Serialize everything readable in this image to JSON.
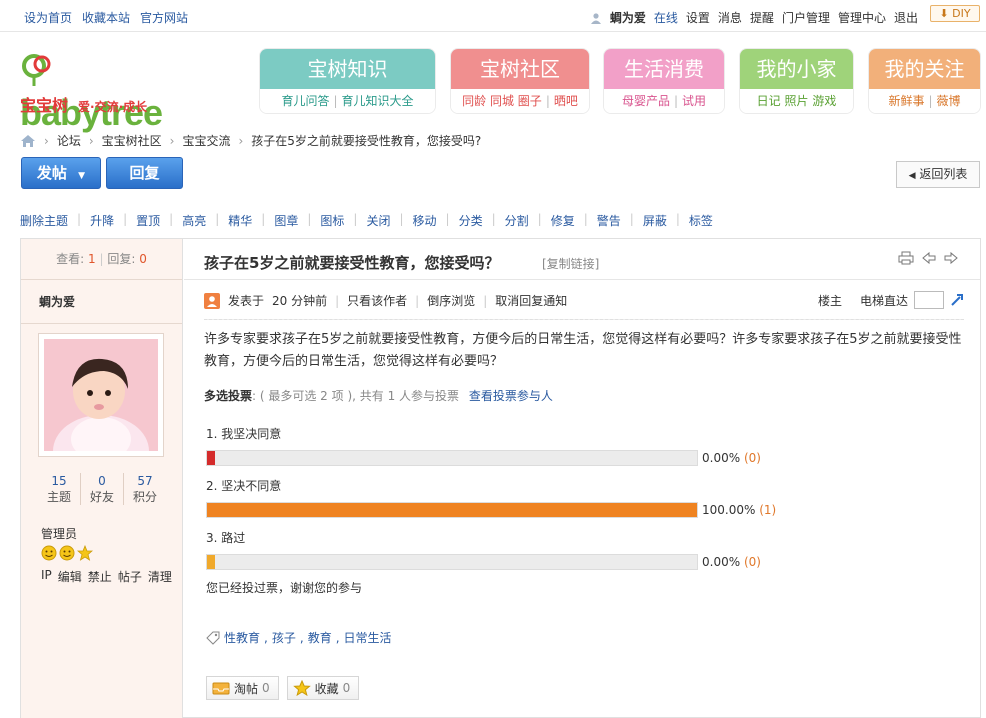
{
  "topbar": {
    "left_links": [
      "设为首页",
      "收藏本站",
      "官方网站"
    ],
    "username": "蜩为爱",
    "online": "在线",
    "user_links": [
      "设置",
      "消息",
      "提醒",
      "门户管理",
      "管理中心",
      "退出"
    ],
    "diy_label": "DIY"
  },
  "logo": {
    "wordmark": "babytree",
    "cn_name": "宝宝树",
    "slogan": "爱·交流·成长"
  },
  "nav_tiles": [
    {
      "title": "宝树知识",
      "links": [
        "育儿问答",
        "育儿知识大全"
      ],
      "head_color": "#7ccbc3",
      "link_color": "#2a9a8a"
    },
    {
      "title": "宝树社区",
      "links": [
        "同龄",
        "同城",
        "圈子",
        "晒吧"
      ],
      "head_color": "#f08f8f",
      "link_color": "#e0504f"
    },
    {
      "title": "生活消费",
      "links": [
        "母婴产品",
        "试用"
      ],
      "head_color": "#f2a0c8",
      "link_color": "#d9558f"
    },
    {
      "title": "我的小家",
      "links": [
        "日记",
        "照片",
        "游戏"
      ],
      "head_color": "#9fd37a",
      "link_color": "#5aa133"
    },
    {
      "title": "我的关注",
      "links": [
        "新鲜事",
        "薇博"
      ],
      "head_color": "#f2b07a",
      "link_color": "#d9772b"
    }
  ],
  "breadcrumb": {
    "items": [
      "论坛",
      "宝宝树社区",
      "宝宝交流"
    ],
    "current": "孩子在5岁之前就要接受性教育，您接受吗?"
  },
  "actions": {
    "post_label": "发帖",
    "reply_label": "回复",
    "back_label": "返回列表"
  },
  "mod_tools": [
    "删除主题",
    "升降",
    "置顶",
    "高亮",
    "精华",
    "图章",
    "图标",
    "关闭",
    "移动",
    "分类",
    "分割",
    "修复",
    "警告",
    "屏蔽",
    "标签"
  ],
  "sidebar": {
    "views_label": "查看:",
    "views": "1",
    "replies_label": "回复:",
    "replies": "0",
    "author": "蜩为爱",
    "stats": [
      {
        "value": "15",
        "label": "主题"
      },
      {
        "value": "0",
        "label": "好友"
      },
      {
        "value": "57",
        "label": "积分"
      }
    ],
    "group": "管理员",
    "admin_links": [
      "IP",
      "编辑",
      "禁止",
      "帖子",
      "清理"
    ]
  },
  "post": {
    "title": "孩子在5岁之前就要接受性教育，您接受吗？",
    "copy_link": "[复制链接]",
    "posted_prefix": "发表于",
    "posted_time": "20 分钟前",
    "only_author": "只看该作者",
    "reverse": "倒序浏览",
    "cancel_notify": "取消回复通知",
    "floor_label": "楼主",
    "jump_label": "电梯直达",
    "body": "许多专家要求孩子在5岁之前就要接受性教育，方便今后的日常生活，您觉得这样有必要吗？许多专家要求孩子在5岁之前就要接受性教育，方便今后的日常生活，您觉得这样有必要吗？"
  },
  "poll": {
    "type_label": "多选投票",
    "limit_text": ": ( 最多可选  2 项 ), 共有  1 人参与投票",
    "view_voters": "查看投票参与人",
    "options": [
      {
        "label": "1.  我坚决同意",
        "percent": 0,
        "percent_text": "0.00%",
        "count": "(0)",
        "color": "#d42b2b"
      },
      {
        "label": "2.  坚决不同意",
        "percent": 100,
        "percent_text": "100.00%",
        "count": "(1)",
        "color": "#ef8321"
      },
      {
        "label": "3.  路过",
        "percent": 0,
        "percent_text": "0.00%",
        "count": "(0)",
        "color": "#f0a92b"
      }
    ],
    "done_text": "您已经投过票，谢谢您的参与"
  },
  "tags": [
    "性教育",
    "孩子",
    "教育",
    "日常生活"
  ],
  "bottom_buttons": [
    {
      "label": "淘帖",
      "count": "0"
    },
    {
      "label": "收藏",
      "count": "0"
    }
  ]
}
